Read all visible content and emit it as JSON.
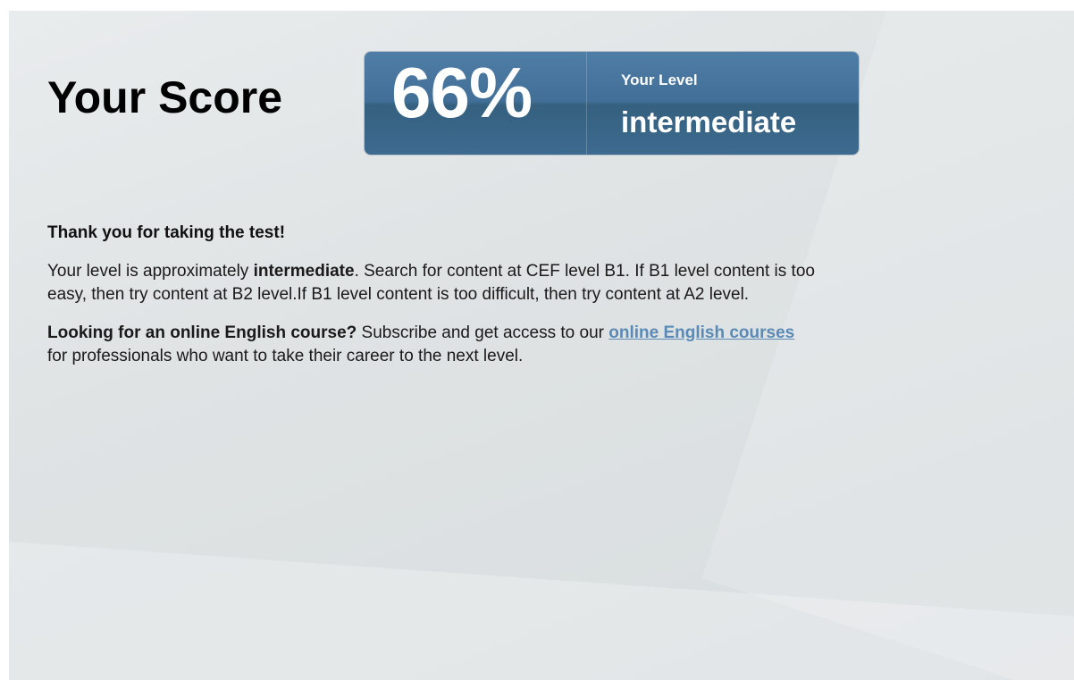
{
  "score": {
    "title": "Your Score",
    "percent": "66%",
    "level_label": "Your Level",
    "level_value": "intermediate"
  },
  "message": {
    "thanks": "Thank you for taking the test!",
    "level_prefix": "Your level is approximately ",
    "level_bold": "intermediate",
    "level_suffix": ". Search for content at CEF level B1. If B1 level content is too easy, then try content at B2 level.If B1 level content is too difficult, then try content at A2 level.",
    "course_bold": "Looking for an online English course?",
    "course_text_before": " Subscribe and get access to our ",
    "course_link": "online English courses",
    "course_text_after": " for professionals who want to take their career to the next level."
  },
  "colors": {
    "score_box": "#426f97",
    "link": "#5a8ab5",
    "background": "#dfe3e4"
  }
}
